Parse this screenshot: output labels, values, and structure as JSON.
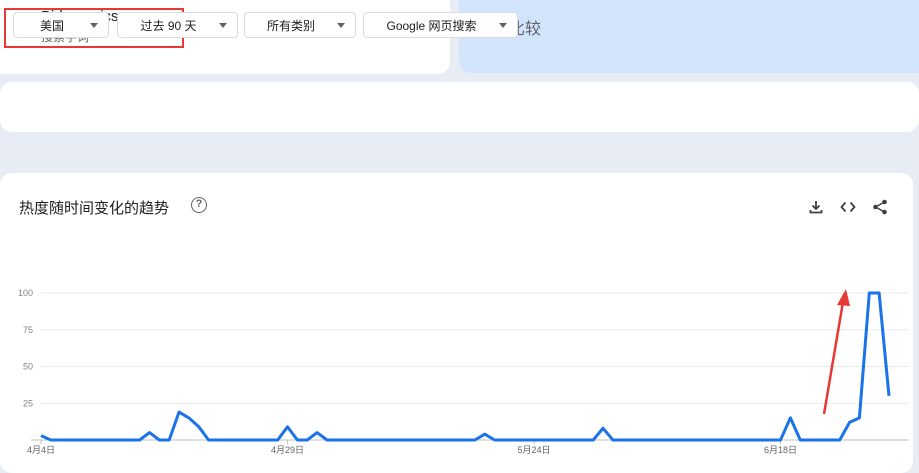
{
  "term": {
    "name": "Bidenomics",
    "type": "搜索字词",
    "color": "#1a73e8"
  },
  "compare": {
    "plus": "+",
    "label": "比较"
  },
  "filters": [
    {
      "label": "美国"
    },
    {
      "label": "过去 90 天"
    },
    {
      "label": "所有类别"
    },
    {
      "label": "Google 网页搜索"
    }
  ],
  "chart_title": "热度随时间变化的趋势",
  "help_icon": "?",
  "toolbar_icons": [
    "download-icon",
    "embed-icon",
    "share-icon"
  ],
  "annotation": {
    "type": "red-arrow",
    "color": "#e53935"
  },
  "chart_data": {
    "type": "line",
    "title": "热度随时间变化的趋势",
    "xlabel": "",
    "ylabel": "",
    "ylim": [
      0,
      100
    ],
    "yticks": [
      25,
      50,
      75,
      100
    ],
    "x_tick_labels": [
      "4月4日",
      "4月29日",
      "5月24日",
      "6月18日"
    ],
    "x_tick_index": [
      0,
      25,
      50,
      75
    ],
    "series": [
      {
        "color": "#1a73e8",
        "values": [
          3,
          0,
          0,
          0,
          0,
          0,
          0,
          0,
          0,
          0,
          0,
          5,
          0,
          0,
          19,
          15,
          9,
          0,
          0,
          0,
          0,
          0,
          0,
          0,
          0,
          9,
          0,
          0,
          5,
          0,
          0,
          0,
          0,
          0,
          0,
          0,
          0,
          0,
          0,
          0,
          0,
          0,
          0,
          0,
          0,
          4,
          0,
          0,
          0,
          0,
          0,
          0,
          0,
          0,
          0,
          0,
          0,
          8,
          0,
          0,
          0,
          0,
          0,
          0,
          0,
          0,
          0,
          0,
          0,
          0,
          0,
          0,
          0,
          0,
          0,
          0,
          15,
          0,
          0,
          0,
          0,
          0,
          12,
          15,
          100,
          100,
          30
        ]
      }
    ],
    "grid": true
  }
}
